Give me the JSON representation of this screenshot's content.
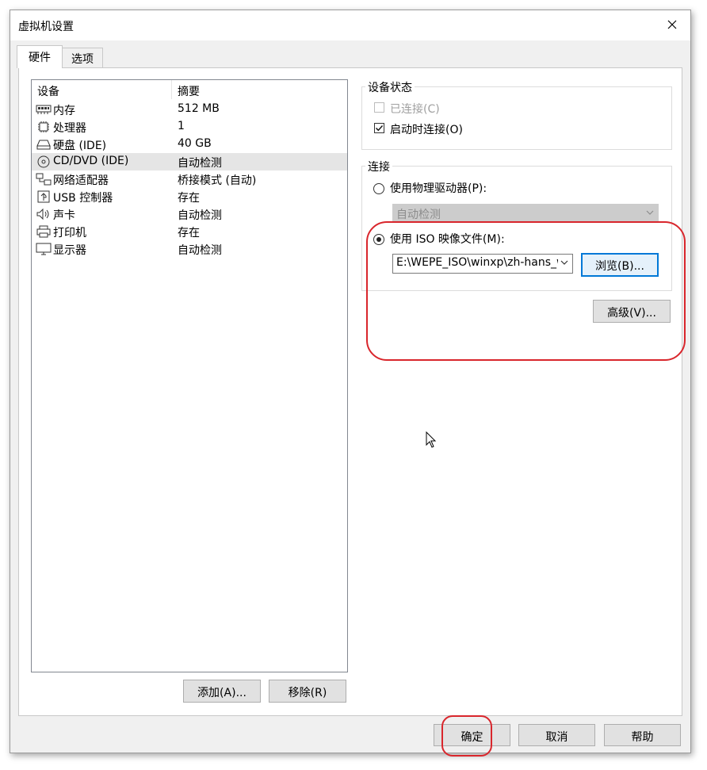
{
  "window": {
    "title": "虚拟机设置"
  },
  "tabs": [
    {
      "label": "硬件"
    },
    {
      "label": "选项"
    }
  ],
  "device_list": {
    "headers": {
      "device": "设备",
      "summary": "摘要"
    },
    "rows": [
      {
        "name": "内存",
        "summary": "512 MB",
        "icon": "memory-icon"
      },
      {
        "name": "处理器",
        "summary": "1",
        "icon": "processor-icon"
      },
      {
        "name": "硬盘 (IDE)",
        "summary": "40 GB",
        "icon": "hard-disk-icon"
      },
      {
        "name": "CD/DVD (IDE)",
        "summary": "自动检测",
        "icon": "cd-dvd-icon",
        "selected": true
      },
      {
        "name": "网络适配器",
        "summary": "桥接模式 (自动)",
        "icon": "network-adapter-icon"
      },
      {
        "name": "USB 控制器",
        "summary": "存在",
        "icon": "usb-icon"
      },
      {
        "name": "声卡",
        "summary": "自动检测",
        "icon": "sound-card-icon"
      },
      {
        "name": "打印机",
        "summary": "存在",
        "icon": "printer-icon"
      },
      {
        "name": "显示器",
        "summary": "自动检测",
        "icon": "display-icon"
      }
    ]
  },
  "list_buttons": {
    "add": "添加(A)...",
    "remove": "移除(R)"
  },
  "device_status": {
    "title": "设备状态",
    "connected": {
      "label": "已连接(C)",
      "checked": false,
      "disabled": true
    },
    "connect_at_power_on": {
      "label": "启动时连接(O)",
      "checked": true
    }
  },
  "connection": {
    "title": "连接",
    "physical": {
      "label": "使用物理驱动器(P):",
      "selected": false,
      "dropdown_value": "自动检测"
    },
    "iso": {
      "label": "使用 ISO 映像文件(M):",
      "selected": true,
      "path": "E:\\WEPE_ISO\\winxp\\zh-hans_windows_xp",
      "browse_label": "浏览(B)..."
    },
    "advanced_label": "高级(V)..."
  },
  "footer": {
    "ok": "确定",
    "cancel": "取消",
    "help": "帮助"
  },
  "colors": {
    "accent": "#0078d7",
    "annotation": "#d9262c",
    "selected_row": "#e5e5e5"
  }
}
